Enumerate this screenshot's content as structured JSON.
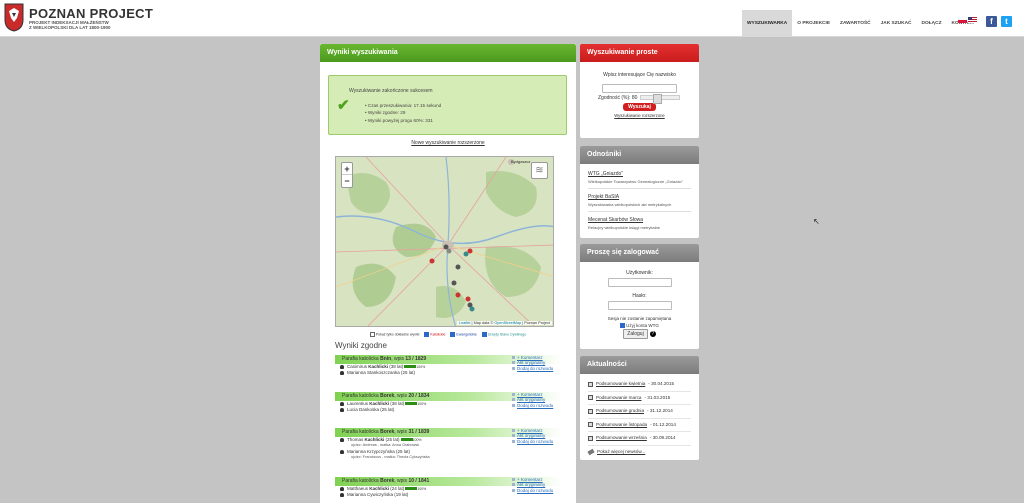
{
  "brand": {
    "title": "POZNAN PROJECT",
    "sub1": "PROJEKT INDEKSACJI MAŁŻEŃSTW",
    "sub2": "Z WIELKOPOLSKI DLA LAT 1800-1900"
  },
  "nav": [
    "WYSZUKIWARKA",
    "O PROJEKCIE",
    "ZAWARTOŚĆ",
    "JAK SZUKAĆ",
    "DOŁĄCZ",
    "KONTAKT"
  ],
  "social": {
    "facebook": "f",
    "twitter": "t"
  },
  "main": {
    "title": "Wyniki wyszukiwania",
    "success_title": "Wyszukiwanie zakończone sukcesem",
    "success_items": [
      "Czas przeszukiwania: 17.15 sekund",
      "Wyniki zgodne: 29",
      "Wyniki powyżej progu 60%: 331"
    ],
    "new_search_link": "Nowe wyszukiwanie rozszerzone",
    "map": {
      "zoom_in": "+",
      "zoom_out": "−",
      "layers": "≋",
      "city_label": "Bydgoszcz",
      "attribution_leaflet": "Leaflet",
      "attribution_text": " | Map data © ",
      "attribution_osm": "OpenStreetMap",
      "attribution_tail": " | Poznan Project"
    },
    "legend": {
      "show_first": "Pokaż tylko dokładne wyniki",
      "catholic": "Katolickie",
      "evangelic": "Ewangelickie",
      "civil": "Urzędy Stanu Cywilnego"
    },
    "results_title": "Wyniki zgodne",
    "actions": {
      "comment": "+ Komentarz",
      "original": "Akt oryginalny",
      "add_tree": "Dodaj do rozwodu"
    },
    "entries": [
      {
        "parish_pre": "Parafia katolicka ",
        "parish": "Bnin",
        "rec_pre": ", wpis ",
        "rec": "13 / 1829",
        "people": [
          {
            "first": "Casimirus ",
            "surname": "Kachlicki",
            "rest": " (38 lat)",
            "pct": "100%",
            "note": ""
          },
          {
            "first": "Marianna Stankoszczanka",
            "surname": "",
            "rest": " (25 lat)",
            "pct": "",
            "note": ""
          }
        ]
      },
      {
        "parish_pre": "Parafia katolicka ",
        "parish": "Borek",
        "rec_pre": ", wpis ",
        "rec": "20 / 1834",
        "people": [
          {
            "first": "Laurentius ",
            "surname": "Kachlicki",
            "rest": " (38 lat)",
            "pct": "100%",
            "note": ""
          },
          {
            "first": "Lucia Dankoska",
            "surname": "",
            "rest": " (25 lat)",
            "pct": "",
            "note": ""
          }
        ]
      },
      {
        "parish_pre": "Parafia katolicka ",
        "parish": "Borek",
        "rec_pre": ", wpis ",
        "rec": "31 / 1839",
        "people": [
          {
            "first": "Thomas ",
            "surname": "Kachlicki",
            "rest": " (25 lat)",
            "pct": "100%",
            "note": "ojciec: Andreas , matka: Anna Grabowsk"
          },
          {
            "first": "Marianna Krzypczyńska",
            "surname": "",
            "rest": " (25 lat)",
            "pct": "",
            "note": "ojciec: Franciscus , matka: Theola Cykszyńska"
          }
        ]
      },
      {
        "parish_pre": "Parafia katolicka ",
        "parish": "Borek",
        "rec_pre": ", wpis ",
        "rec": "10 / 1841",
        "people": [
          {
            "first": "Matthaeus ",
            "surname": "Kachlicki",
            "rest": " (24 lat)",
            "pct": "100%",
            "note": ""
          },
          {
            "first": "Marianna Cywiczyńska",
            "surname": "",
            "rest": " (19 lat)",
            "pct": "",
            "note": ""
          }
        ]
      }
    ]
  },
  "simple_search": {
    "title": "Wyszukiwanie proste",
    "prompt": "Wpisz interesujące Cię nazwisko",
    "similarity_label": "Zgodność (%): 80",
    "button": "Wyszukaj",
    "advanced_link": "Wyszukiwanie rozszerzone"
  },
  "links": {
    "title": "Odnośniki",
    "items": [
      {
        "title": "WTG „Gniazdo”",
        "desc": "Wielkopolskie Towarzystwo Genealogiczne „Gniazdo”"
      },
      {
        "title": "Projekt BaSIA",
        "desc": "Wyszukiwarka wielkopolskich akt metrykalnych"
      },
      {
        "title": "Mecenat Skarbów Słowa",
        "desc": "Relacjny wielkopolskie księgi metrykalne"
      }
    ]
  },
  "login": {
    "title": "Proszę się zalogować",
    "user_label": "Użytkownik:",
    "pass_label": "Hasło:",
    "remember_label": "Sesja nie zostanie zapamiętana",
    "wtg_label": "Użyj konta WTG",
    "submit": "Zaloguj",
    "help": "?"
  },
  "news": {
    "title": "Aktualności",
    "items": [
      {
        "title": "Podsumowanie kwietnia",
        "date": " - 30.04.2015"
      },
      {
        "title": "Podsumowanie marca",
        "date": " - 31.03.2015"
      },
      {
        "title": "Podsumowanie grudnia",
        "date": " - 31.12.2014"
      },
      {
        "title": "Podsumowanie listopada",
        "date": " - 01.12.2014"
      },
      {
        "title": "Podsumowanie września",
        "date": " - 30.09.2014"
      }
    ],
    "more": "Pokaż więcej newsów..."
  },
  "colors": {
    "green": "#5aa828",
    "red": "#d42020",
    "gray": "#8a8a8a",
    "link": "#2a6ebb"
  }
}
